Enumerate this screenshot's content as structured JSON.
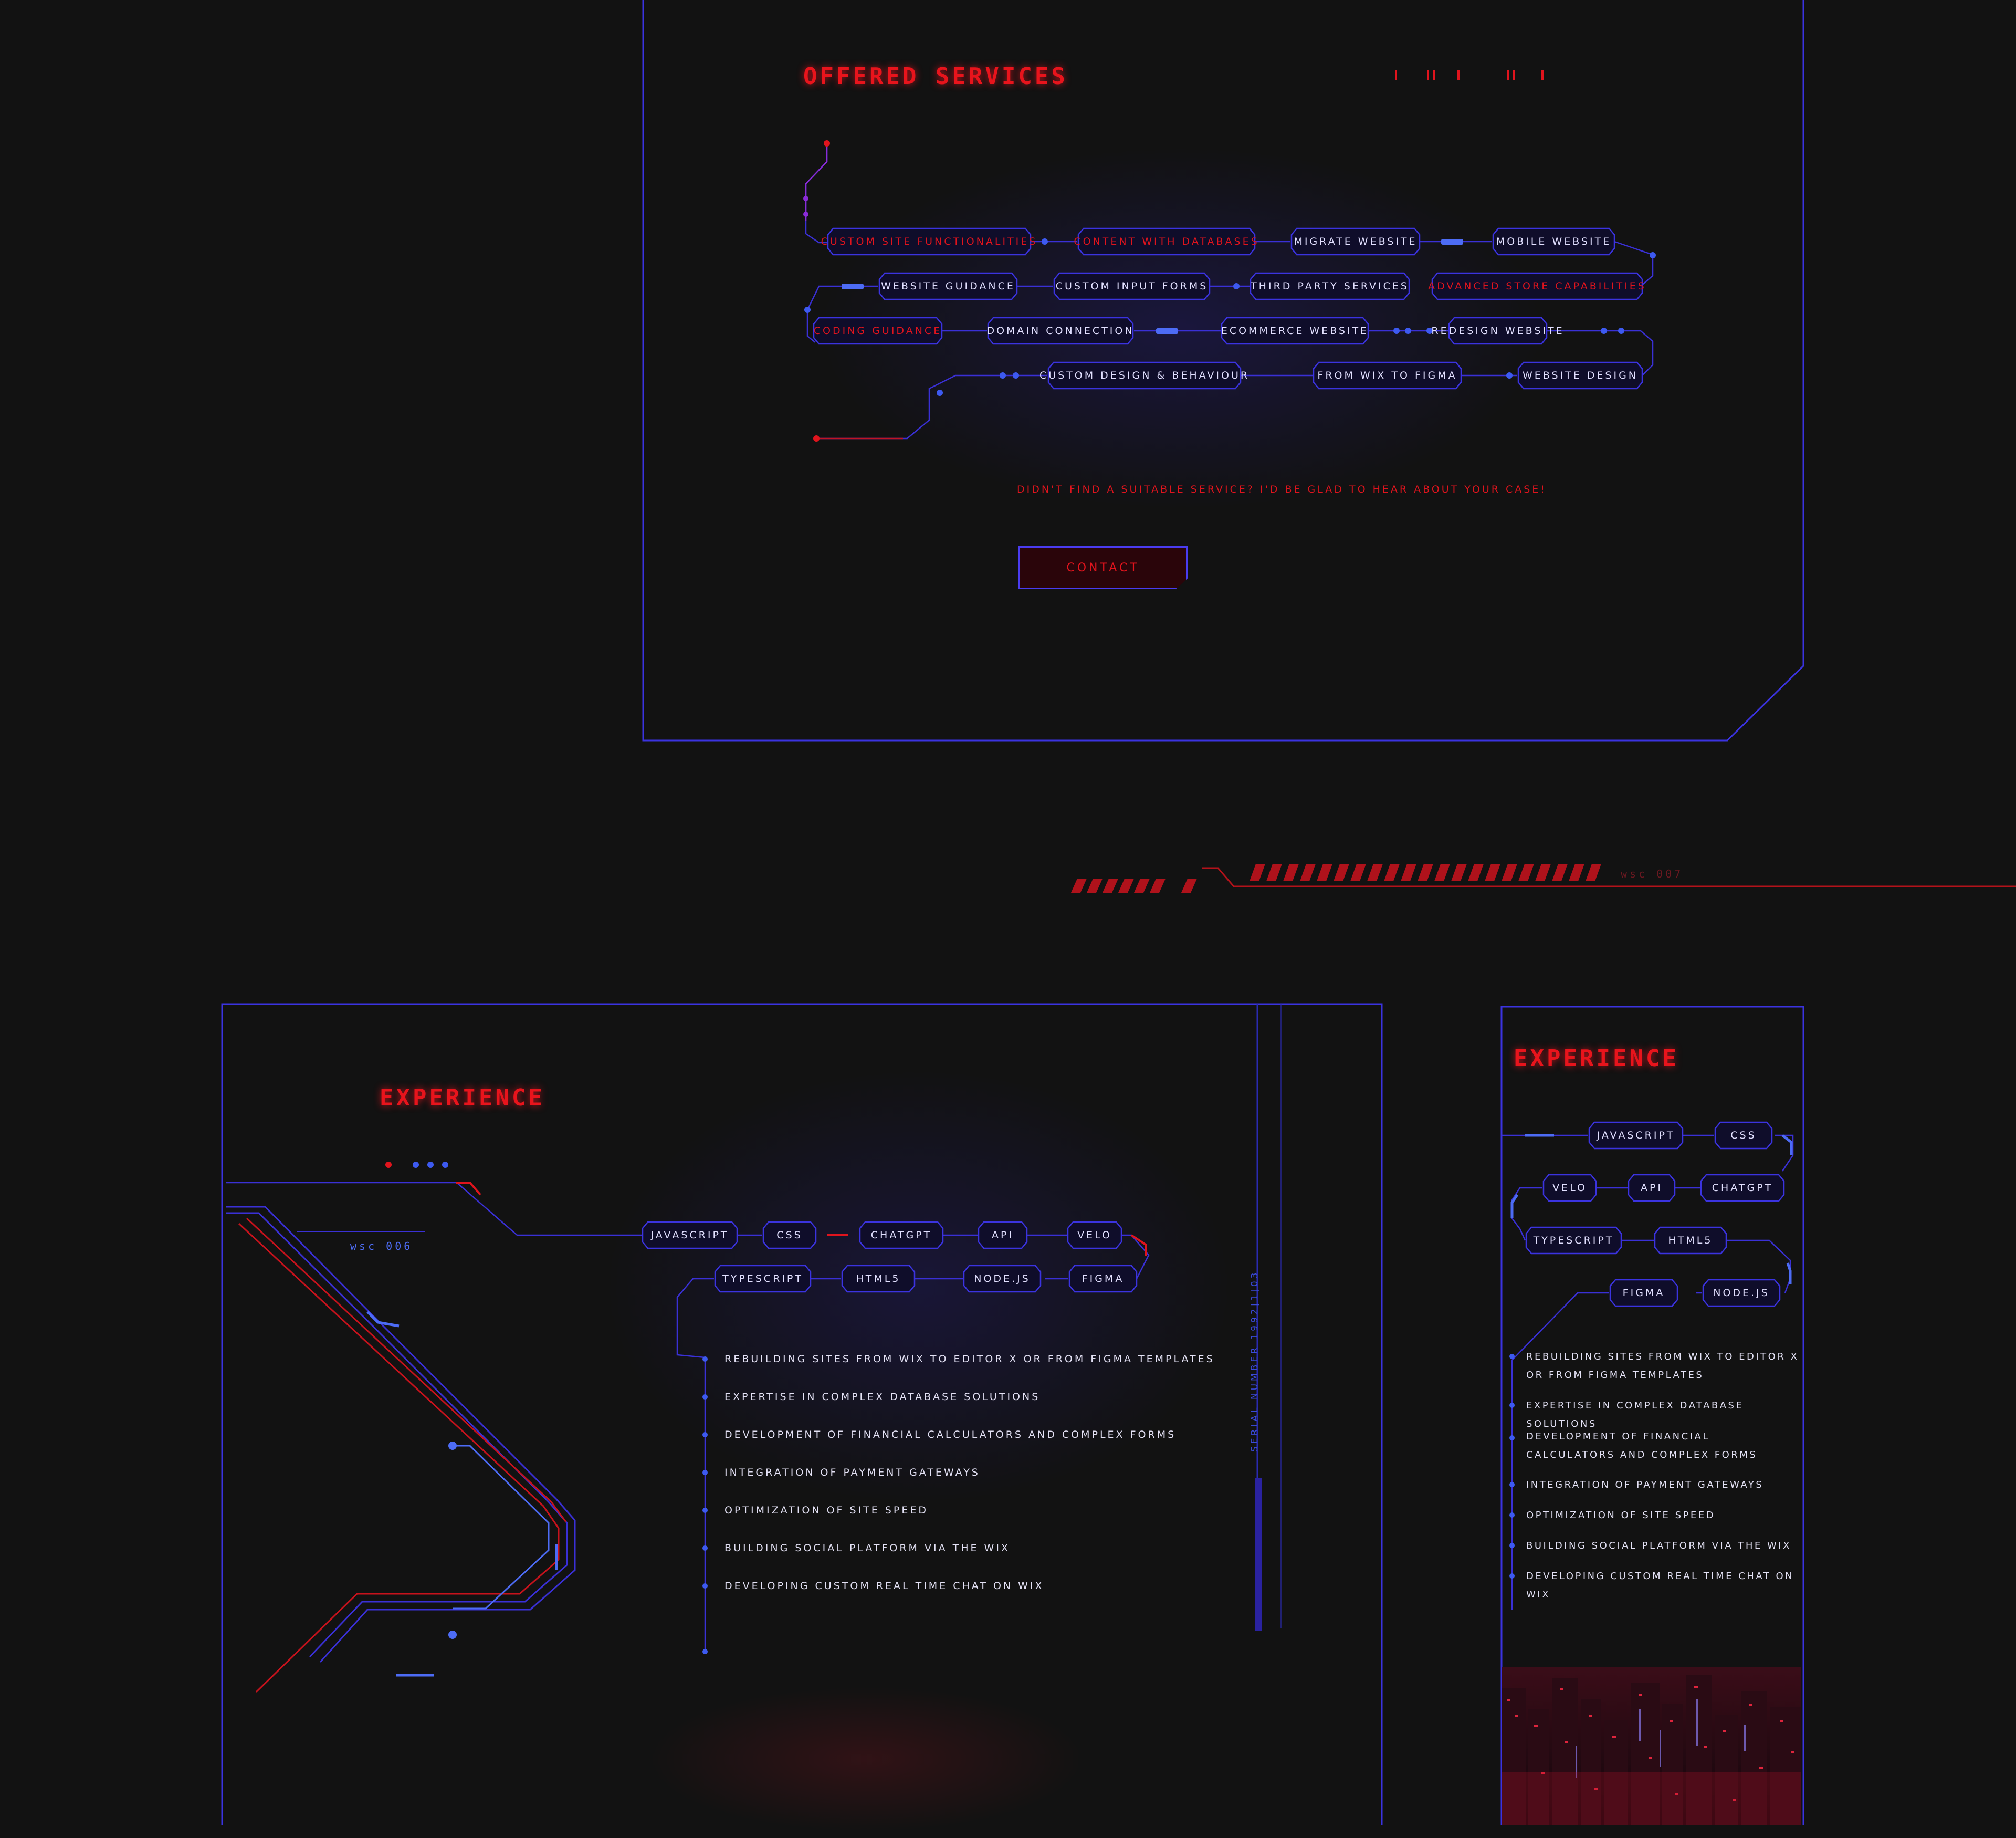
{
  "colors": {
    "background": "#121212",
    "border_blue": "#3b33e0",
    "accent_red": "#e8141c",
    "node_blue": "#4b6ff0"
  },
  "services": {
    "title": "OFFERED SERVICES",
    "rows": [
      [
        {
          "label": "Custom site functionalities",
          "accent": true
        },
        {
          "label": "Content with databases",
          "accent": true
        },
        {
          "label": "Migrate website",
          "accent": false
        },
        {
          "label": "Mobile website",
          "accent": false
        }
      ],
      [
        {
          "label": "Website guidance",
          "accent": false
        },
        {
          "label": "Custom input forms",
          "accent": false
        },
        {
          "label": "Third party services",
          "accent": false
        },
        {
          "label": "Advanced store capabilities",
          "accent": true
        }
      ],
      [
        {
          "label": "Coding guidance",
          "accent": true
        },
        {
          "label": "Domain connection",
          "accent": false
        },
        {
          "label": "eCommerce website",
          "accent": false
        },
        {
          "label": "Redesign website",
          "accent": false
        }
      ],
      [
        {
          "label": "Custom design & behaviour",
          "accent": false
        },
        {
          "label": "From Wix to Figma",
          "accent": false
        },
        {
          "label": "Website design",
          "accent": false
        }
      ]
    ],
    "cta_text": "DIDN'T FIND A SUITABLE SERVICE? I'D BE GLAD TO HEAR ABOUT YOUR CASE!",
    "contact_label": "CONTACT"
  },
  "divider": {
    "code": "wsc 007"
  },
  "experience": {
    "title": "EXPERIENCE",
    "code": "wsc 006",
    "serial": "SERIAL NUMBER 1992|1|03",
    "skills_row1": [
      "JavaScript",
      "CSS",
      "ChatGPT",
      "API",
      "Velo"
    ],
    "skills_row2": [
      "TypeScript",
      "HTML5",
      "Node.js",
      "Figma"
    ],
    "bullets": [
      "Rebuilding sites from wix to editor x or from figma templates",
      "Expertise in complex database solutions",
      "Development of financial calculators and complex forms",
      "Integration of payment gateways",
      "Optimization of site speed",
      "Building social platform via the wix",
      "Developing custom real time chat on wix"
    ]
  },
  "experience_mobile": {
    "title": "EXPERIENCE",
    "skills_rows": [
      [
        "JavaScript",
        "CSS"
      ],
      [
        "Velo",
        "API",
        "ChatGPT"
      ],
      [
        "TypeScript",
        "HTML5"
      ],
      [
        "Figma",
        "Node.js"
      ]
    ],
    "bullets": [
      "Rebuilding sites from wix to editor x or from figma templates",
      "Expertise in complex database solutions",
      "Development of financial calculators and complex forms",
      "Integration of payment gateways",
      "Optimization of site speed",
      "Building social platform via the wix",
      "Developing custom real time chat on wix"
    ]
  }
}
